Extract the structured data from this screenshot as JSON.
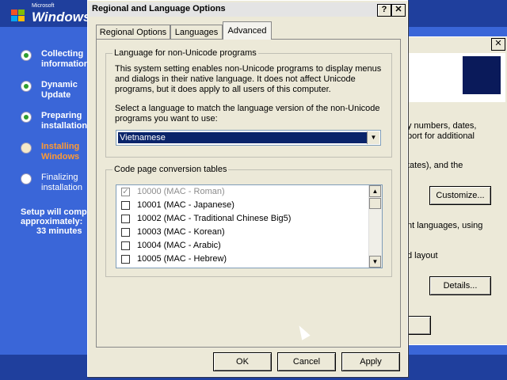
{
  "setup": {
    "logo_small": "Microsoft",
    "logo": "Windows",
    "steps": [
      {
        "label": "Collecting\ninformation",
        "state": "done"
      },
      {
        "label": "Dynamic\nUpdate",
        "state": "done"
      },
      {
        "label": "Preparing\ninstallation",
        "state": "done"
      },
      {
        "label": "Installing\nWindows",
        "state": "current"
      },
      {
        "label": "Finalizing\ninstallation",
        "state": "pending"
      }
    ],
    "remaining_line1": "Setup will comp",
    "remaining_line2": "approximately:",
    "remaining_line3": "33 minutes"
  },
  "back_dialog": {
    "close": "✕",
    "text1": "y numbers, dates,",
    "text2": "port for additional",
    "text3": "tates), and the",
    "customize": "Customize...",
    "text4": "nt languages, using",
    "text5": "d layout",
    "details": "Details..."
  },
  "dialog": {
    "title": "Regional and Language Options",
    "help": "?",
    "close": "✕",
    "tabs": [
      "Regional Options",
      "Languages",
      "Advanced"
    ],
    "group1_label": "Language for non-Unicode programs",
    "desc1": "This system setting enables non-Unicode programs to display menus",
    "desc2": "and dialogs in their native language. It does not affect Unicode",
    "desc3": "programs, but it does apply to all users of this computer.",
    "prompt1": "Select a language to match the language version of the non-Unicode",
    "prompt2": "programs you want to use:",
    "language_selected": "Vietnamese",
    "group2_label": "Code page conversion tables",
    "codepages": [
      {
        "label": "10000 (MAC - Roman)",
        "checked": true,
        "disabled": true
      },
      {
        "label": "10001 (MAC - Japanese)",
        "checked": false,
        "disabled": false
      },
      {
        "label": "10002 (MAC - Traditional Chinese Big5)",
        "checked": false,
        "disabled": false
      },
      {
        "label": "10003 (MAC - Korean)",
        "checked": false,
        "disabled": false
      },
      {
        "label": "10004 (MAC - Arabic)",
        "checked": false,
        "disabled": false
      },
      {
        "label": "10005 (MAC - Hebrew)",
        "checked": false,
        "disabled": false
      }
    ],
    "ok": "OK",
    "cancel": "Cancel",
    "apply": "Apply"
  },
  "colors": {
    "accent": "#0a246a",
    "setup_blue": "#3a66d8",
    "current_step": "#ff9a33"
  }
}
